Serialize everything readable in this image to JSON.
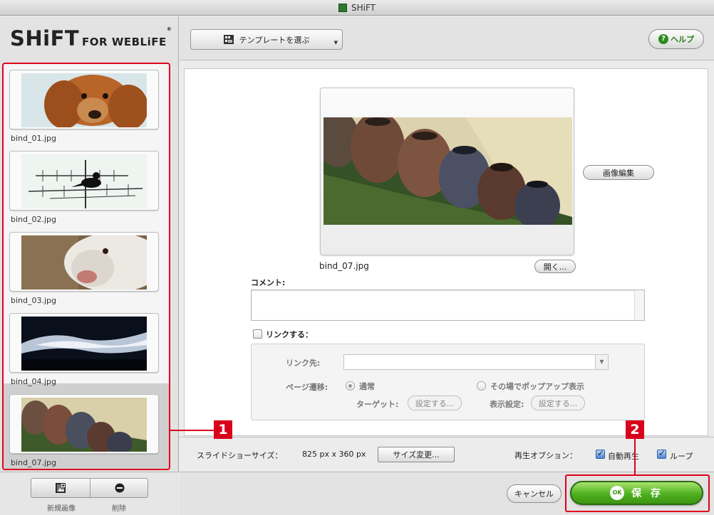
{
  "window": {
    "title": "SHiFT"
  },
  "logo": {
    "main": "SHiFT",
    "sub": "FOR WEBLiFE"
  },
  "thumbnails": [
    {
      "name": "bind_01.jpg",
      "subject": "dog"
    },
    {
      "name": "bind_02.jpg",
      "subject": "bird-on-antenna"
    },
    {
      "name": "bind_03.jpg",
      "subject": "white-dog"
    },
    {
      "name": "bind_04.jpg",
      "subject": "sky-clouds"
    },
    {
      "name": "bind_07.jpg",
      "subject": "jars",
      "selected": true
    }
  ],
  "left_footer": {
    "new_label": "新規画像",
    "delete_label": "削除"
  },
  "toolbar": {
    "template_label": "テンプレートを選ぶ",
    "help_label": "ヘルプ",
    "help_mark": "?"
  },
  "editor": {
    "image_name": "bind_07.jpg",
    "edit_image_label": "画像編集",
    "open_label": "開く...",
    "comment_label": "コメント:",
    "comment_value": "",
    "link_checkbox_label": "リンクする：",
    "link_checked": false,
    "link_target_label": "リンク先:",
    "link_target_value": "",
    "page_transition_label": "ページ遷移:",
    "transition_normal_label": "通常",
    "transition_popup_label": "その場でポップアップ表示",
    "target_label": "ターゲット:",
    "target_setting_label": "設定する...",
    "display_setting_label": "表示設定:",
    "display_setting_button": "設定する..."
  },
  "options": {
    "slideshow_size_label": "スライドショーサイズ：",
    "slideshow_size_value": "825 px x 360 px",
    "resize_label": "サイズ変更...",
    "playback_label": "再生オプション：",
    "autoplay_label": "自動再生",
    "autoplay_checked": true,
    "loop_label": "ループ",
    "loop_checked": true
  },
  "footer": {
    "cancel_label": "キャンセル",
    "save_label": "保 存",
    "ok_badge": "OK"
  },
  "callouts": {
    "one": "1",
    "two": "2"
  },
  "colors": {
    "callout": "#d8001a",
    "save_green": "#4fb01f",
    "help_green": "#2c8a1e"
  }
}
